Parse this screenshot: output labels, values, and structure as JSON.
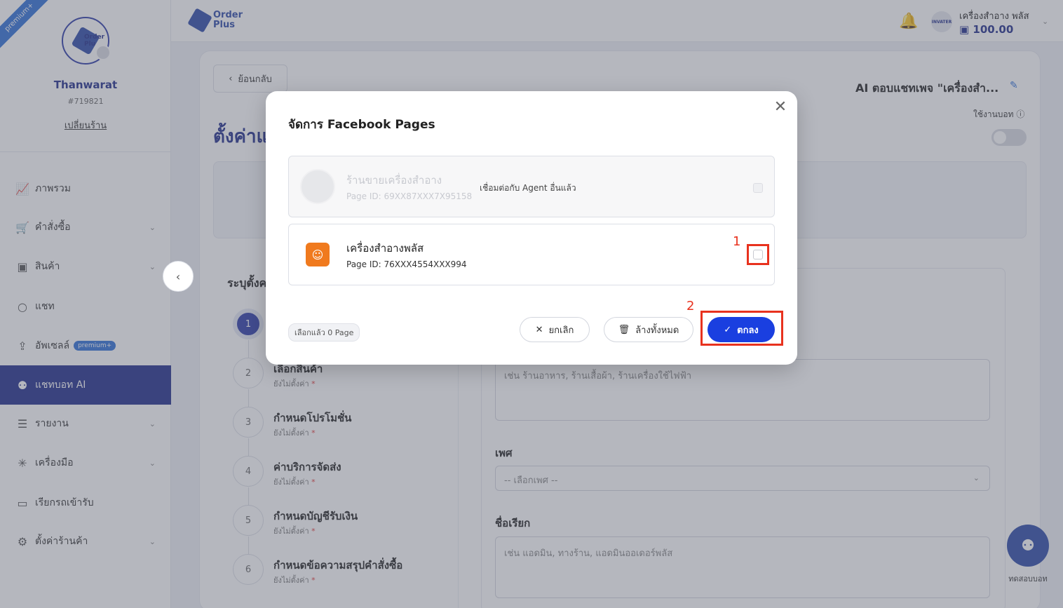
{
  "sidebar": {
    "ribbon": "premium+",
    "user_name": "Thanwarat",
    "user_id": "#719821",
    "change_shop": "เปลี่ยนร้าน",
    "avatar_text": "Order Plu",
    "items": [
      {
        "label": "ภาพรวม",
        "icon": "chart-icon"
      },
      {
        "label": "คำสั่งซื้อ",
        "icon": "cart-icon"
      },
      {
        "label": "สินค้า",
        "icon": "box-icon"
      },
      {
        "label": "แชท",
        "icon": "chat-icon"
      },
      {
        "label": "อัพเซลล์",
        "icon": "upsell-icon",
        "badge": "premium+"
      },
      {
        "label": "แชทบอท AI",
        "icon": "bot-icon"
      },
      {
        "label": "รายงาน",
        "icon": "report-icon"
      },
      {
        "label": "เครื่องมือ",
        "icon": "tools-icon"
      },
      {
        "label": "เรียกรถเข้ารับ",
        "icon": "truck-icon"
      },
      {
        "label": "ตั้งค่าร้านค้า",
        "icon": "gear-icon"
      }
    ]
  },
  "topbar": {
    "logo_line1": "Order",
    "logo_line2": "Plus",
    "shop_name": "เครื่องสำอาง พลัส",
    "shop_avatar": "INVATER",
    "balance": "100.00"
  },
  "main": {
    "back_label": "ย้อนกลับ",
    "title_partial": "ตั้งค่าแ",
    "ai_title": "AI ตอบแชทเพจ \"เครื่องสำ...",
    "use_label": "ใช้งานบอท",
    "specify_label": "ระบุตั้งค",
    "steps": [
      {
        "num": "1",
        "title": "",
        "sub": ""
      },
      {
        "num": "2",
        "title": "เลือกสินค้า",
        "sub": "ยังไม่ตั้งค่า"
      },
      {
        "num": "3",
        "title": "กำหนดโปรโมชั่น",
        "sub": "ยังไม่ตั้งค่า"
      },
      {
        "num": "4",
        "title": "ค่าบริการจัดส่ง",
        "sub": "ยังไม่ตั้งค่า"
      },
      {
        "num": "5",
        "title": "กำหนดบัญชีรับเงิน",
        "sub": "ยังไม่ตั้งค่า"
      },
      {
        "num": "6",
        "title": "กำหนดข้อความสรุปคำสั่งซื้อ",
        "sub": "ยังไม่ตั้งค่า"
      }
    ],
    "required_mark": "*",
    "business_placeholder": "เช่น ร้านอาหาร, ร้านเสื้อผ้า, ร้านเครื่องใช้ไฟฟ้า",
    "gender_label": "เพศ",
    "gender_select": "-- เลือกเพศ --",
    "nickname_label": "ชื่อเรียก",
    "nickname_placeholder": "เช่น แอดมิน, ทางร้าน, แอดมินออเดอร์พลัส",
    "chat_test_label": "ทดสอบบอท"
  },
  "modal": {
    "title": "จัดการ Facebook Pages",
    "pages": [
      {
        "name": "ร้านขายเครื่องสำอาง",
        "page_id": "Page ID: 69XX87XXX7X95158",
        "note": "เชื่อมต่อกับ Agent อื่นแล้ว",
        "disabled": true
      },
      {
        "name": "เครื่องสำอางพลัส",
        "page_id": "Page ID: 76XXX4554XXX994",
        "note": "",
        "disabled": false
      }
    ],
    "selected_count": "เลือกแล้ว 0 Page",
    "cancel_label": "ยกเลิก",
    "clear_label": "ล้างทั้งหมด",
    "ok_label": "ตกลง",
    "annotation_1": "1",
    "annotation_2": "2"
  }
}
